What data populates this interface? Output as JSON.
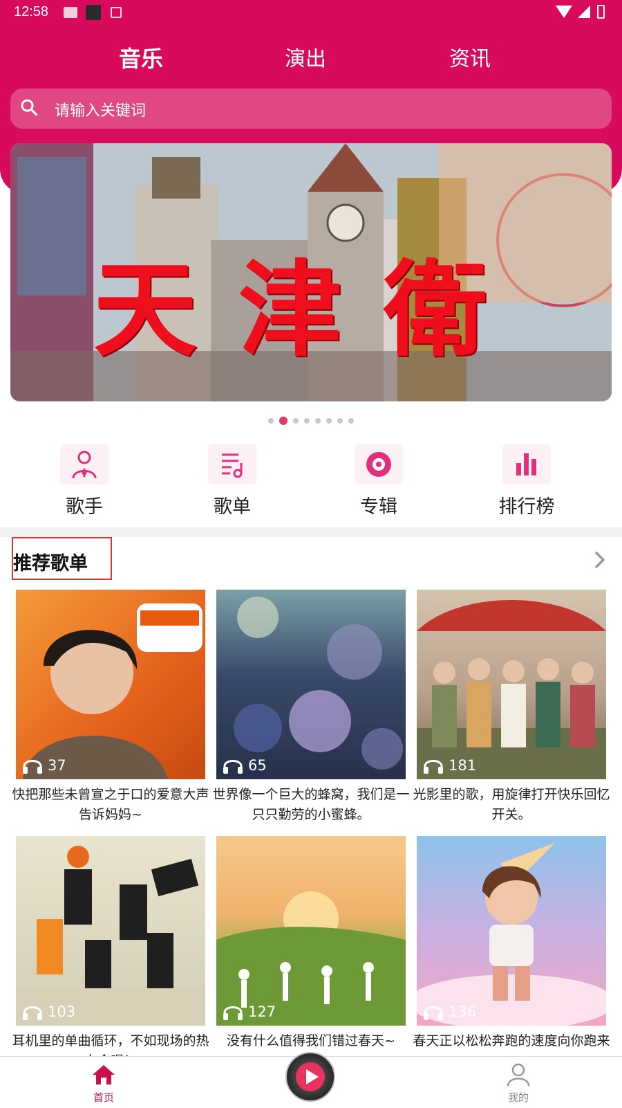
{
  "status_bar": {
    "time": "12:58"
  },
  "top_tabs": [
    {
      "label": "音乐",
      "active": true
    },
    {
      "label": "演出",
      "active": false
    },
    {
      "label": "资讯",
      "active": false
    }
  ],
  "search": {
    "placeholder": "请输入关键词"
  },
  "banner": {
    "title": "天津衛",
    "page_count": 8,
    "active_index": 1
  },
  "quick_nav": [
    {
      "label": "歌手",
      "icon": "singer-icon"
    },
    {
      "label": "歌单",
      "icon": "playlist-icon"
    },
    {
      "label": "专辑",
      "icon": "album-icon"
    },
    {
      "label": "排行榜",
      "icon": "chart-icon"
    }
  ],
  "section": {
    "title": "推荐歌单"
  },
  "playlists": [
    {
      "count": "37",
      "title": "快把那些未曾宣之于口的爱意大声告诉妈妈~"
    },
    {
      "count": "65",
      "title": "世界像一个巨大的蜂窝，我们是一只只勤劳的小蜜蜂。"
    },
    {
      "count": "181",
      "title": "光影里的歌，用旋律打开快乐回忆开关。"
    },
    {
      "count": "103",
      "title": "耳机里的单曲循环，不如现场的热血合唱！"
    },
    {
      "count": "127",
      "title": "没有什么值得我们错过春天~"
    },
    {
      "count": "136",
      "title": "春天正以松松奔跑的速度向你跑来"
    }
  ],
  "tabbar": {
    "home_label": "首页",
    "mine_label": "我的"
  },
  "colors": {
    "brand": "#d80a5c",
    "accent": "#e8345f"
  }
}
